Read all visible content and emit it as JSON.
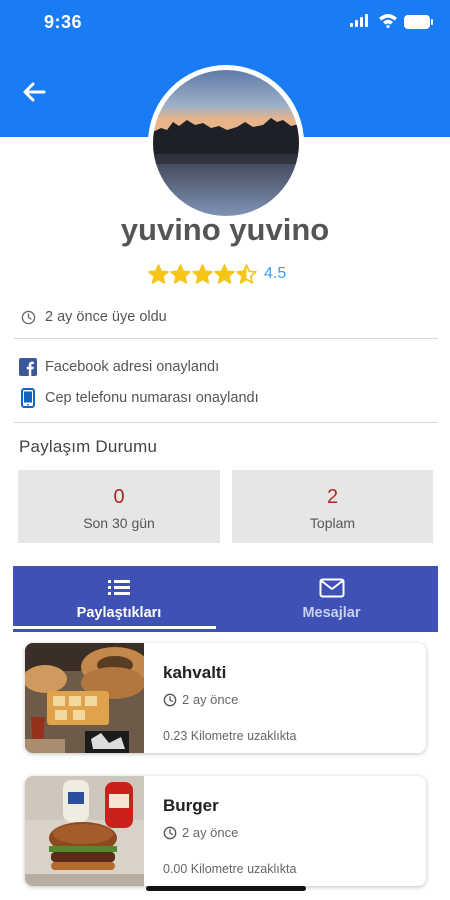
{
  "status_bar": {
    "time": "9:36"
  },
  "profile": {
    "name": "yuvino yuvino",
    "rating_value": "4.5",
    "rating_stars": 4.5,
    "member_since": "2 ay önce üye oldu"
  },
  "verifications": {
    "facebook": "Facebook adresi onaylandı",
    "phone": "Cep telefonu numarası onaylandı"
  },
  "share_status": {
    "title": "Paylaşım Durumu",
    "stats": [
      {
        "value": "0",
        "label": "Son 30 gün"
      },
      {
        "value": "2",
        "label": "Toplam"
      }
    ]
  },
  "tabs": [
    {
      "label": "Paylaştıkları",
      "icon": "list-icon",
      "active": true
    },
    {
      "label": "Mesajlar",
      "icon": "mail-icon",
      "active": false
    }
  ],
  "posts": [
    {
      "title": "kahvalti",
      "time": "2 ay önce",
      "distance": "0.23 Kilometre uzaklıkta",
      "image": "breakfast-photo"
    },
    {
      "title": "Burger",
      "time": "2 ay önce",
      "distance": "0.00 Kilometre uzaklıkta",
      "image": "burger-photo"
    }
  ],
  "colors": {
    "header_blue": "#1a7cf5",
    "tabbar_indigo": "#3f51b5",
    "star_gold": "#f5c518",
    "rating_text_blue": "#36a3f7",
    "stat_value_red": "#b02a20",
    "stat_box_gray": "#e6e6e6"
  }
}
